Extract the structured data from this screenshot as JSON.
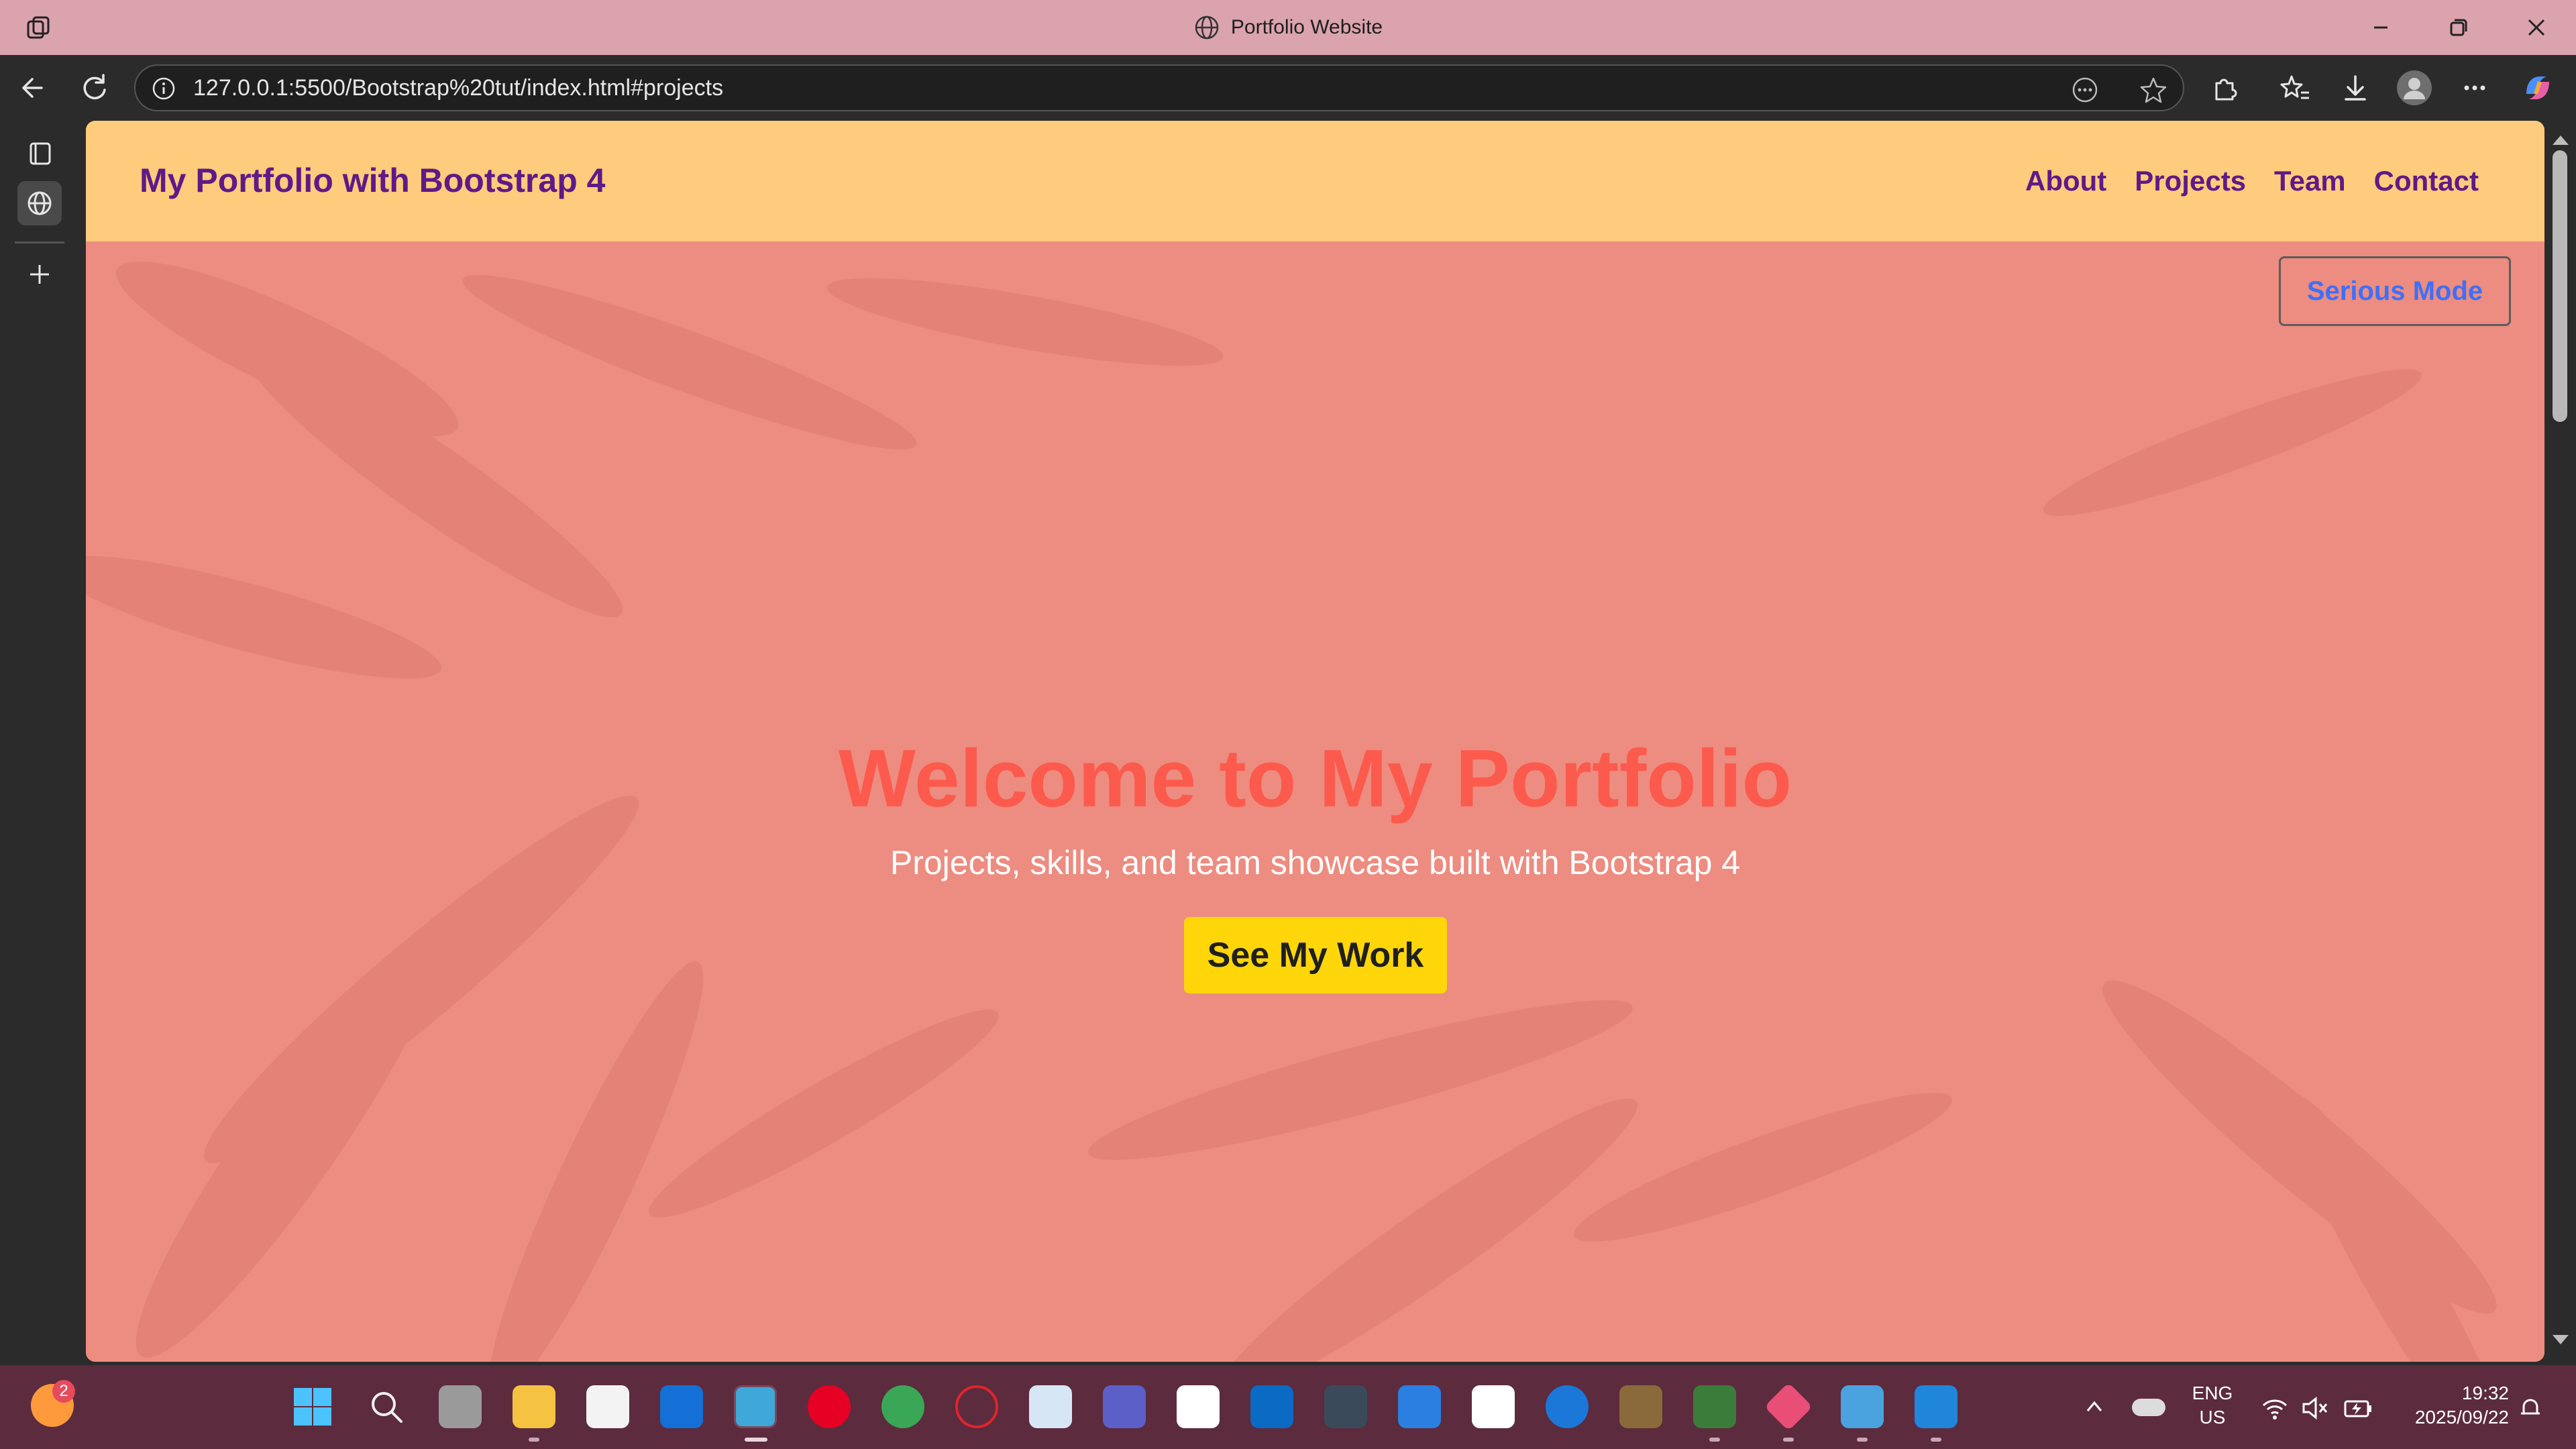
{
  "window": {
    "title": "Portfolio Website"
  },
  "browser": {
    "url": "127.0.0.1:5500/Bootstrap%20tut/index.html#projects"
  },
  "page": {
    "brand": "My Portfolio with Bootstrap 4",
    "nav": [
      "About",
      "Projects",
      "Team",
      "Contact"
    ],
    "serious_mode_label": "Serious Mode",
    "hero_title": "Welcome to My Portfolio",
    "hero_subtitle": "Projects, skills, and team showcase built with Bootstrap 4",
    "cta_label": "See My Work"
  },
  "taskbar": {
    "firefox_badge": "2",
    "lang_line1": "ENG",
    "lang_line2": "US",
    "time": "19:32",
    "date": "2025/09/22"
  },
  "colors": {
    "titlebar": "#dba3ad",
    "navbar": "#ffcb7c",
    "brand_text": "#5e1a87",
    "hero_bg": "#ed8c80",
    "hero_title": "#fb5a4d",
    "serious_mode_text": "#3f6ff7",
    "cta_bg": "#ffd60a",
    "taskbar": "#5c2b3e"
  }
}
